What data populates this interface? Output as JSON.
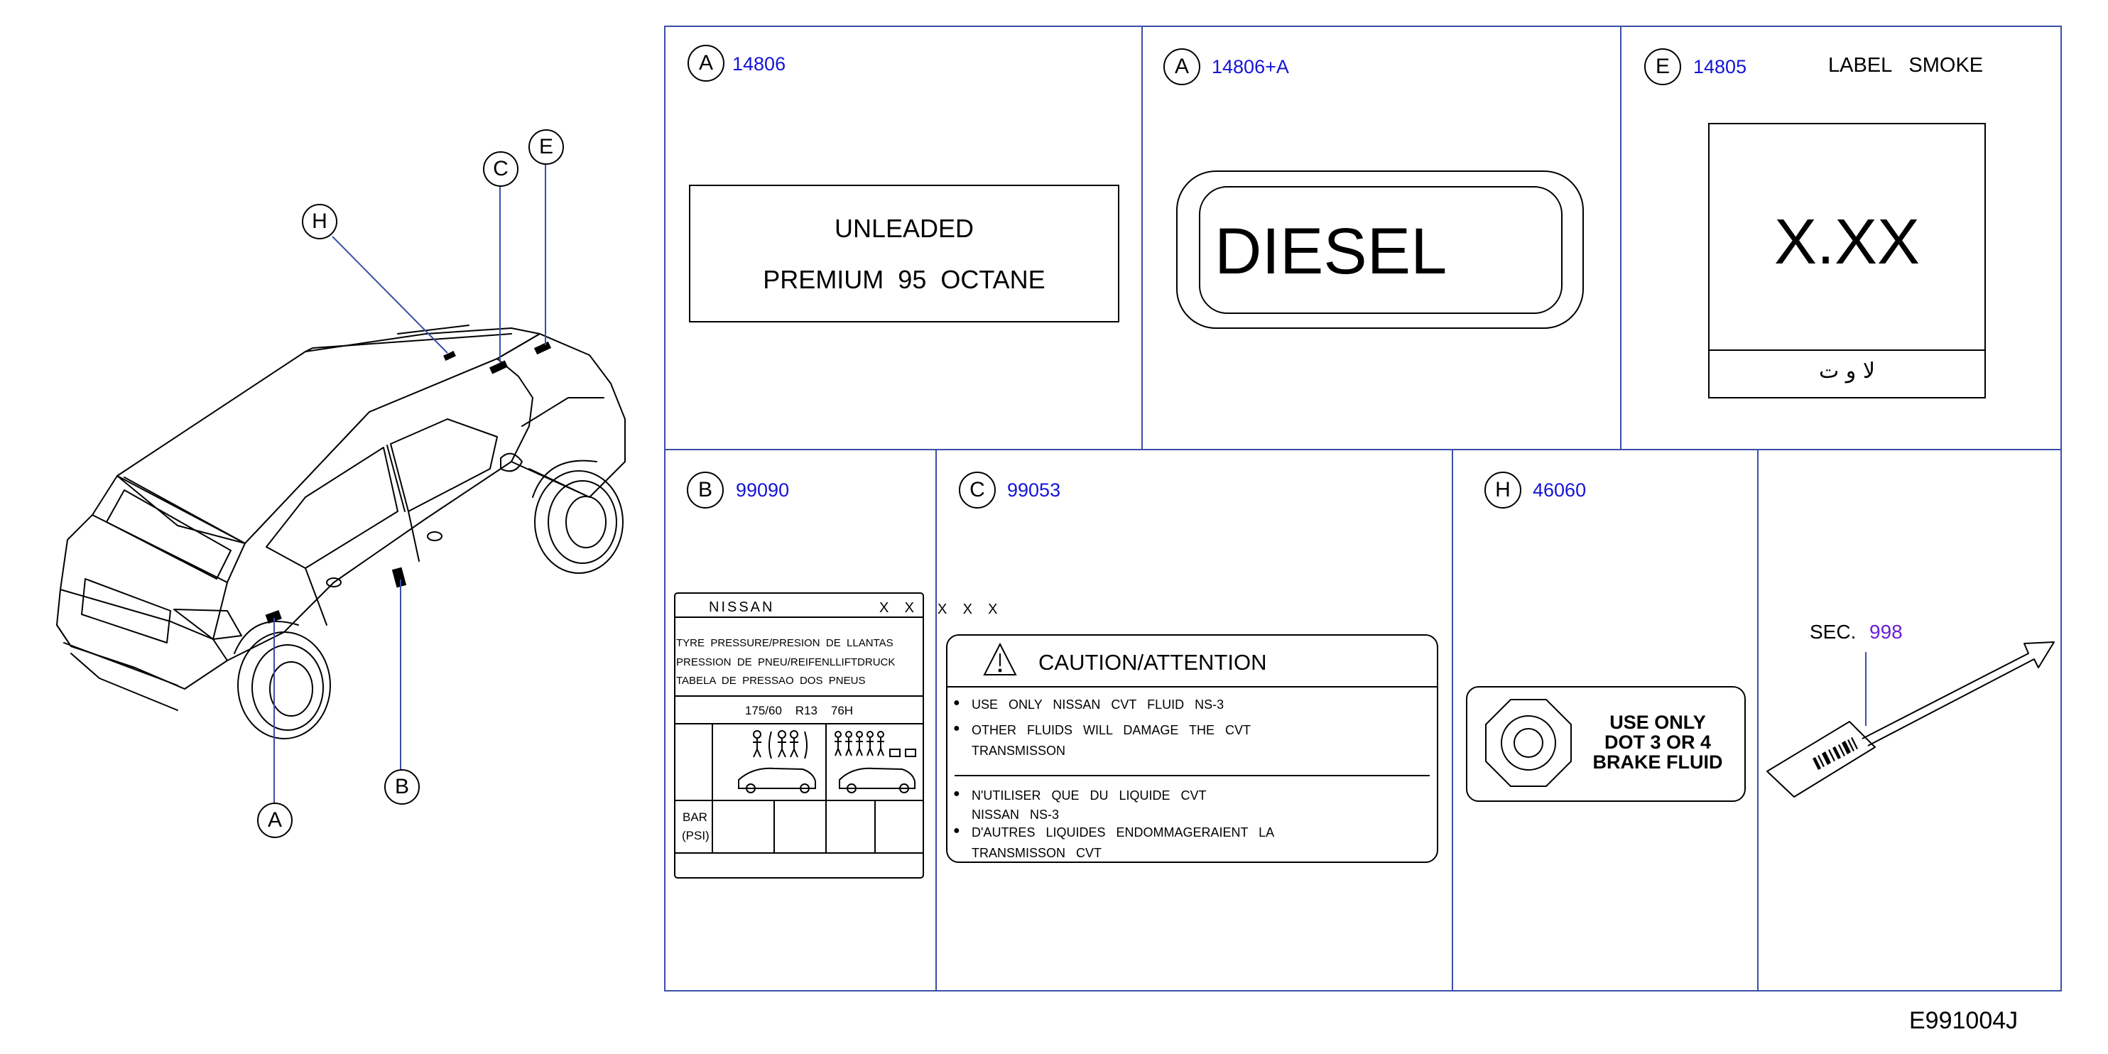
{
  "diagram_code": "E991004J",
  "callouts": {
    "vehicle": [
      "H",
      "C",
      "E",
      "A",
      "B"
    ]
  },
  "panels": {
    "a1": {
      "letter": "A",
      "part_no": "14806",
      "line1": "UNLEADED",
      "line2": "PREMIUM  95  OCTANE"
    },
    "a2": {
      "letter": "A",
      "part_no": "14806+A",
      "text": "DIESEL"
    },
    "e": {
      "letter": "E",
      "part_no": "14805",
      "title": "LABEL   SMOKE",
      "value": "X.XX",
      "glyph": "ﻻ ﻭ ﺕ"
    },
    "b": {
      "letter": "B",
      "part_no": "99090",
      "brand": "NISSAN",
      "marks": "X    X",
      "lines": [
        "TYRE  PRESSURE/PRESION  DE  LLANTAS",
        "PRESSION  DE  PNEU/REIFENLLIFTDRUCK",
        "TABELA  DE  PRESSAO  DOS  PNEUS"
      ],
      "tyre_size": "175/60    R13    76H",
      "unit_label_1": "BAR",
      "unit_label_2": "(PSI)"
    },
    "c": {
      "letter": "C",
      "part_no": "99053",
      "marks": "X    X    X",
      "header": "CAUTION/ATTENTION",
      "en_1": "USE   ONLY   NISSAN   CVT   FLUID   NS-3",
      "en_2a": "OTHER   FLUIDS   WILL   DAMAGE   THE   CVT",
      "en_2b": "TRANSMISSON",
      "fr_1a": "N'UTILISER   QUE   DU   LIQUIDE   CVT",
      "fr_1b": "NISSAN   NS-3",
      "fr_2a": "D'AUTRES   LIQUIDES   ENDOMMAGERAIENT   LA",
      "fr_2b": "TRANSMISSON   CVT"
    },
    "h": {
      "letter": "H",
      "part_no": "46060",
      "line1": "USE ONLY",
      "line2": "DOT 3 OR 4",
      "line3": "BRAKE FLUID"
    },
    "sec": {
      "prefix": "SEC.",
      "number": "998"
    }
  },
  "colors": {
    "frame": "#3a4fa8",
    "part_no": "#1414d6",
    "sec_no": "#6a1fd6"
  }
}
